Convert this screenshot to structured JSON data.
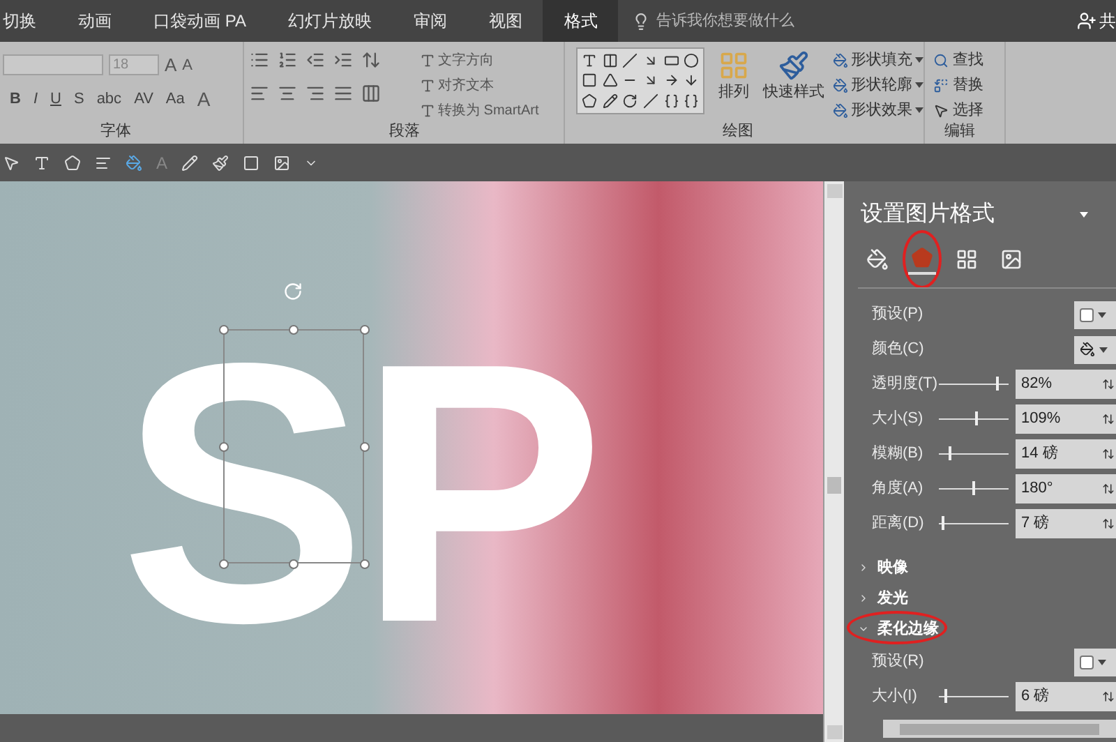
{
  "tabs": [
    {
      "label": "切换",
      "selected": false
    },
    {
      "label": "动画",
      "selected": false
    },
    {
      "label": "口袋动画 PA",
      "selected": false
    },
    {
      "label": "幻灯片放映",
      "selected": false
    },
    {
      "label": "审阅",
      "selected": false
    },
    {
      "label": "视图",
      "selected": false
    },
    {
      "label": "格式",
      "selected": true
    }
  ],
  "tell_me": {
    "placeholder": "告诉我你想要做什么"
  },
  "share": {
    "label": "共"
  },
  "ribbon": {
    "font": {
      "font_size": "18",
      "size_buttons": [
        "A",
        "A"
      ],
      "format_buttons": [
        "B",
        "I",
        "U",
        "S",
        "abc",
        "AV",
        "Aa"
      ],
      "color_button": "A",
      "label": "字体"
    },
    "paragraph": {
      "buttons": [
        "文字方向",
        "对齐文本",
        "转换为 SmartArt"
      ],
      "label": "段落"
    },
    "drawing": {
      "arrange": "排列",
      "quick_styles": "快速样式",
      "buttons": [
        "形状填充",
        "形状轮廓",
        "形状效果"
      ],
      "label": "绘图"
    },
    "editing": {
      "buttons": [
        "查找",
        "替换",
        "选择"
      ],
      "label": "编辑"
    }
  },
  "toolbar": {
    "text_color": "A",
    "text_color_disabled": true
  },
  "slide": {
    "text": "SP"
  },
  "panel": {
    "title": "设置图片格式",
    "tabs": [
      {
        "selected": false,
        "highlighted": false
      },
      {
        "selected": true,
        "highlighted": true
      },
      {
        "selected": false,
        "highlighted": false
      },
      {
        "selected": false,
        "highlighted": false
      }
    ],
    "rows": [
      {
        "kind": "preset",
        "label": "预设(P)"
      },
      {
        "kind": "color",
        "label": "颜色(C)"
      },
      {
        "kind": "slider",
        "label": "透明度(T)",
        "level": 0.85,
        "value": "82%"
      },
      {
        "kind": "slider",
        "label": "大小(S)",
        "level": 0.55,
        "value": "109%"
      },
      {
        "kind": "slider",
        "label": "模糊(B)",
        "level": 0.15,
        "value": "14 磅"
      },
      {
        "kind": "slider",
        "label": "角度(A)",
        "level": 0.5,
        "value": "180°"
      },
      {
        "kind": "slider",
        "label": "距离(D)",
        "level": 0.05,
        "value": "7 磅"
      }
    ],
    "sections": [
      {
        "label": "映像",
        "expanded": false,
        "highlighted": false
      },
      {
        "label": "发光",
        "expanded": false,
        "highlighted": false
      },
      {
        "label": "柔化边缘",
        "expanded": true,
        "highlighted": true,
        "rows": [
          {
            "kind": "preset",
            "label": "预设(R)"
          },
          {
            "kind": "slider",
            "label": "大小(I)",
            "level": 0.08,
            "value": "6 磅"
          }
        ]
      }
    ]
  }
}
